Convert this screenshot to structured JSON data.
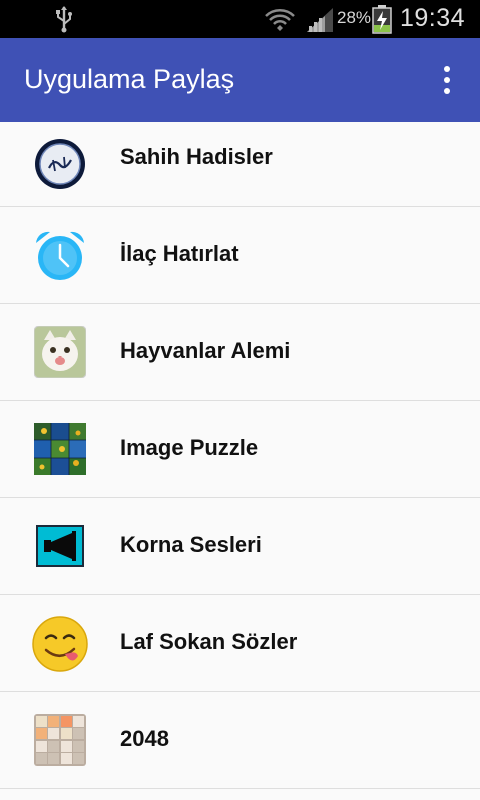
{
  "status_bar": {
    "battery_percent": "28%",
    "time": "19:34",
    "icons": [
      "usb-icon",
      "wifi-icon",
      "signal-icon",
      "battery-charging-icon"
    ]
  },
  "app_bar": {
    "title": "Uygulama Paylaş",
    "overflow_icon": "more-vert-icon",
    "color": "#3f51b5"
  },
  "apps": [
    {
      "label": "Sahih Hadisler",
      "icon": "calligraphy-icon"
    },
    {
      "label": "İlaç Hatırlat",
      "icon": "alarm-clock-icon"
    },
    {
      "label": "Hayvanlar Alemi",
      "icon": "kitten-photo-icon"
    },
    {
      "label": "Image Puzzle",
      "icon": "puzzle-photo-icon"
    },
    {
      "label": "Korna Sesleri",
      "icon": "horn-icon"
    },
    {
      "label": "Laf Sokan Sözler",
      "icon": "smiley-tongue-icon"
    },
    {
      "label": "2048",
      "icon": "2048-grid-icon"
    }
  ]
}
